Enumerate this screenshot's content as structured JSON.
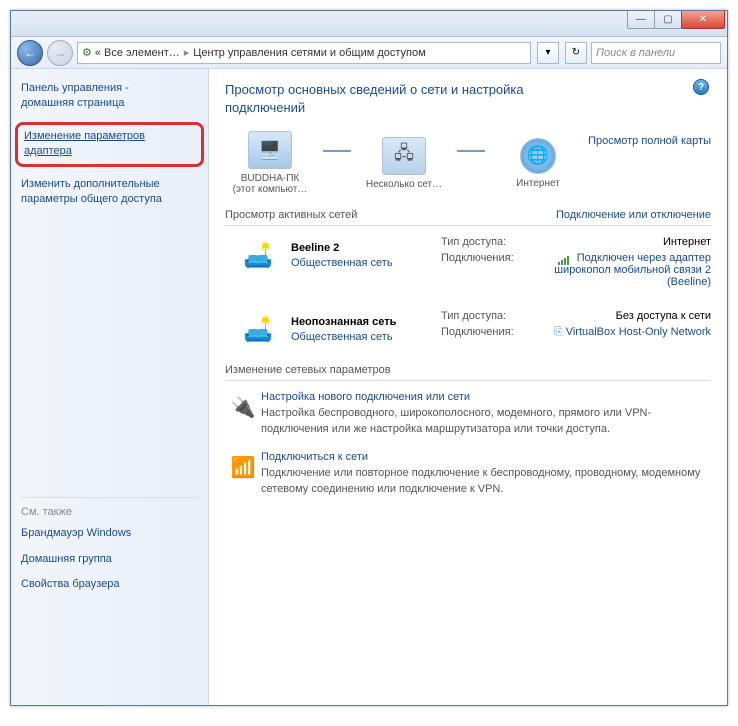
{
  "window": {
    "minimize": "—",
    "maximize": "▢",
    "close": "✕"
  },
  "addressbar": {
    "back": "←",
    "forward": "→",
    "icon": "⚙",
    "crumb1": "« Все элемент…",
    "crumb2": "Центр управления сетями и общим доступом",
    "refresh": "↻",
    "chevron": "▾",
    "search_placeholder": "Поиск в панели"
  },
  "sidebar": {
    "home_line1": "Панель управления -",
    "home_line2": "домашняя страница",
    "link_adapter": "Изменение параметров адаптера",
    "link_sharing": "Изменить дополнительные параметры общего доступа",
    "seealso": "См. также",
    "firewall": "Брандмауэр Windows",
    "homegroup": "Домашняя группа",
    "browser": "Свойства браузера"
  },
  "main": {
    "title": "Просмотр основных сведений о сети и настройка подключений",
    "help": "?",
    "fullmap": "Просмотр полной карты",
    "node_pc_name": "BUDDHA-ПК",
    "node_pc_sub": "(этот компьют…",
    "node_multi": "Несколько сет…",
    "node_internet": "Интернет",
    "activehead": "Просмотр активных сетей",
    "connectlink": "Подключение или отключение",
    "kv_access": "Тип доступа:",
    "kv_conn": "Подключения:",
    "net1": {
      "name": "Beeline 2",
      "type": "Общественная сеть",
      "access_val": "Интернет",
      "conn_val": "Подключен через адаптер широкопол мобильной связи 2 (Beeline)"
    },
    "net2": {
      "name": "Неопознанная сеть",
      "type": "Общественная сеть",
      "access_val": "Без доступа к сети",
      "conn_val": "VirtualBox Host-Only Network"
    },
    "changesec": "Изменение сетевых параметров",
    "change1_title": "Настройка нового подключения или сети",
    "change1_desc": "Настройка беспроводного, широкополосного, модемного, прямого или VPN-подключения или же настройка маршрутизатора или точки доступа.",
    "change2_title": "Подключиться к сети",
    "change2_desc": "Подключение или повторное подключение к беспроводному, проводному, модемному сетевому соединению или подключение к VPN."
  }
}
